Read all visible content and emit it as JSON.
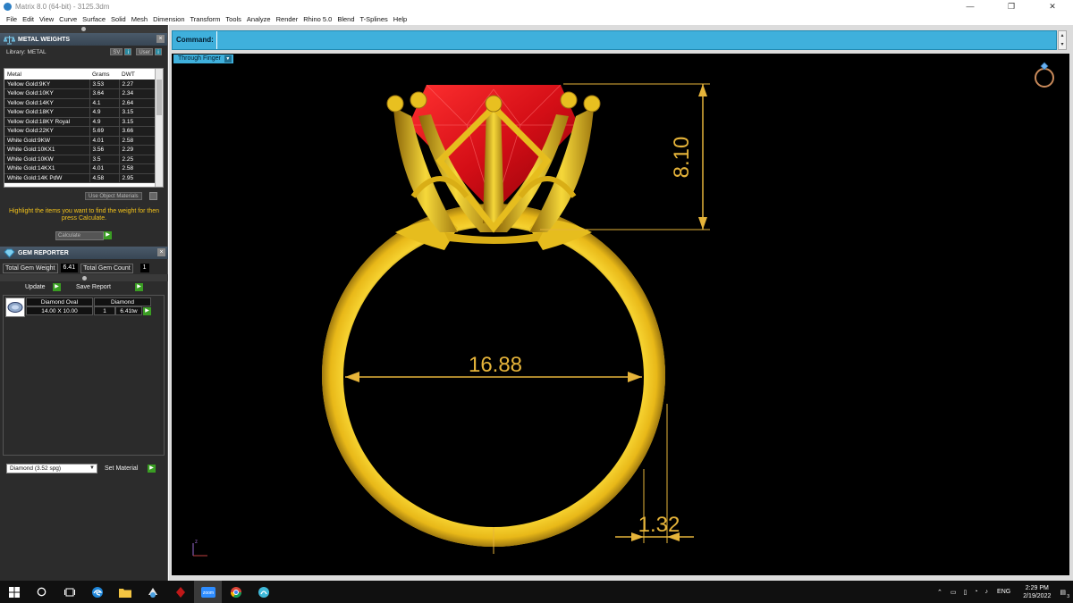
{
  "window": {
    "title": "Matrix 8.0 (64-bit) - 3125.3dm",
    "minimize": "—",
    "maximize": "❐",
    "close": "✕"
  },
  "menu": [
    "File",
    "Edit",
    "View",
    "Curve",
    "Surface",
    "Solid",
    "Mesh",
    "Dimension",
    "Transform",
    "Tools",
    "Analyze",
    "Render",
    "Rhino 5.0",
    "Blend",
    "T-Splines",
    "Help"
  ],
  "metal_weights": {
    "title": "METAL WEIGHTS",
    "library_label": "Library: METAL",
    "sv_label": "SV",
    "user_label": "User",
    "columns": [
      "Metal",
      "Grams",
      "DWT"
    ],
    "rows": [
      [
        "Yellow Gold:9KY",
        "3.53",
        "2.27"
      ],
      [
        "Yellow Gold:10KY",
        "3.64",
        "2.34"
      ],
      [
        "Yellow Gold:14KY",
        "4.1",
        "2.64"
      ],
      [
        "Yellow Gold:18KY",
        "4.9",
        "3.15"
      ],
      [
        "Yellow Gold:18KY Royal",
        "4.9",
        "3.15"
      ],
      [
        "Yellow Gold:22KY",
        "5.69",
        "3.66"
      ],
      [
        "White Gold:9KW",
        "4.01",
        "2.58"
      ],
      [
        "White Gold:10KX1",
        "3.56",
        "2.29"
      ],
      [
        "White Gold:10KW",
        "3.5",
        "2.25"
      ],
      [
        "White Gold:14KX1",
        "4.01",
        "2.58"
      ],
      [
        "White Gold:14K PdW",
        "4.58",
        "2.95"
      ]
    ],
    "use_object_materials": "Use Object Materials",
    "hint": "Highlight the items you want to find the weight for then press Calculate.",
    "calculate_label": "Calculate"
  },
  "gem_reporter": {
    "title": "GEM REPORTER",
    "total_weight_label": "Total Gem Weight",
    "total_weight_value": "6.41",
    "total_count_label": "Total Gem Count",
    "total_count_value": "1",
    "update_label": "Update",
    "save_report_label": "Save Report",
    "gem": {
      "name": "Diamond Oval",
      "size": "14.00 X 10.00",
      "material": "Diamond",
      "count": "1",
      "weight": "6.41tw"
    }
  },
  "material_select": {
    "value": "Diamond     (3.52 spg)",
    "set_label": "Set Material"
  },
  "command": {
    "label": "Command:",
    "value": ""
  },
  "viewport": {
    "tab_label": "Through Finger",
    "dimensions": {
      "height": "8.10",
      "inner_diameter": "16.88",
      "shank_thickness": "1.32"
    },
    "axis_label": "z",
    "colors": {
      "gold": "#f0c81e",
      "ruby": "#e0121a",
      "dimension": "#e6b43a"
    }
  },
  "taskbar": {
    "icons": [
      "start-icon",
      "search-icon",
      "task-view-icon",
      "edge-icon",
      "file-explorer-icon",
      "app-icon",
      "matrix-icon",
      "zoom-icon",
      "chrome-icon",
      "app2-icon"
    ],
    "language": "ENG",
    "time": "2:29 PM",
    "date": "2/19/2022",
    "notification_count": "3"
  }
}
